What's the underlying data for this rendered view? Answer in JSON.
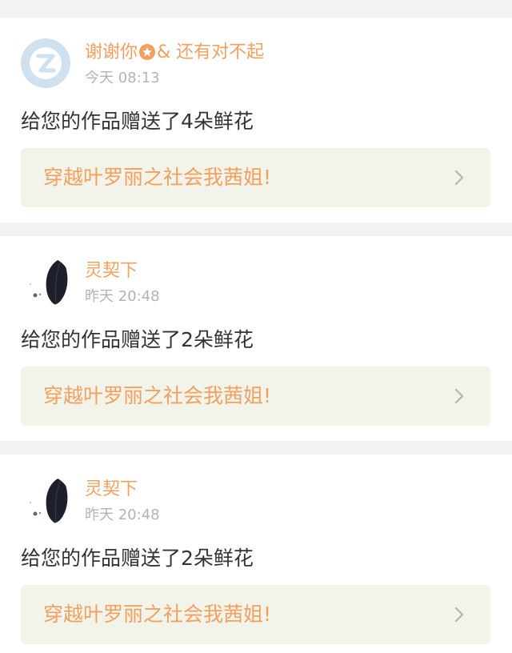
{
  "colors": {
    "accent": "#f2a060",
    "muted": "#b3b3b3",
    "text": "#333333",
    "link_bg": "#f2f4ea",
    "page_bg": "#f2f2f2"
  },
  "notifications": [
    {
      "avatar_icon": "default-z-avatar-icon",
      "user_name_part1": "谢谢你",
      "badge_icon": "star-badge-icon",
      "user_name_part2": "& 还有对不起",
      "time": "今天 08:13",
      "message": "给您的作品赠送了4朵鲜花",
      "work_title": "穿越叶罗丽之社会我茜姐!"
    },
    {
      "avatar_icon": "feather-avatar-icon",
      "user_name": "灵契下",
      "time": "昨天 20:48",
      "message": "给您的作品赠送了2朵鲜花",
      "work_title": "穿越叶罗丽之社会我茜姐!"
    },
    {
      "avatar_icon": "feather-avatar-icon",
      "user_name": "灵契下",
      "time": "昨天 20:48",
      "message": "给您的作品赠送了2朵鲜花",
      "work_title": "穿越叶罗丽之社会我茜姐!"
    }
  ]
}
